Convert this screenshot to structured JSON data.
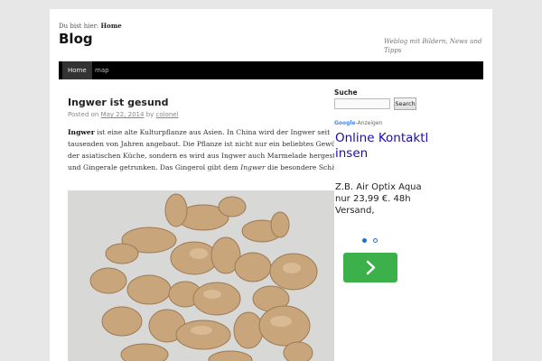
{
  "header": {
    "breadcrumb_prefix": "Du bist hier:",
    "breadcrumb_current": "Home",
    "site_title": "Blog",
    "site_description": "Weblog mit Bildern, News und Tipps"
  },
  "nav": {
    "items": [
      {
        "label": "Home",
        "active": true
      },
      {
        "label": "map",
        "active": false
      }
    ]
  },
  "post": {
    "title": "Ingwer ist gesund",
    "meta_prefix": "Posted on",
    "date": "May 22, 2014",
    "meta_by": "by",
    "author": "colonel",
    "intro_bold": "Ingwer",
    "text_1": " ist eine alte Kulturpflanze aus Asien. In China wird der Ingwer seit tausenden von Jahren angebaut. Die Pflanze ist nicht nur ein beliebtes Gewürz in der asiatischen Küche, sondern es wird aus Ingwer auch Marmelade hergestellt und Gingerale getrunken. Das Gingerol gibt dem ",
    "italic_word": "Ingwer",
    "text_2": " die besondere Schärfe."
  },
  "sidebar": {
    "search_title": "Suche",
    "search_value": "",
    "search_button": "Search",
    "ad": {
      "label_brand": "Google",
      "label_suffix": "-Anzeigen",
      "headline": "Online Kontaktlinsen",
      "body": "Z.B. Air Optix Aqua nur 23,99 €. 48h Versand,",
      "arrow_icon": "chevron-right-icon",
      "colors": {
        "headline": "#1a0dab",
        "button": "#3cb04a",
        "dots": "#1e6fd9"
      }
    }
  },
  "colors": {
    "nav_background": "#000000",
    "page_background": "#e7e7e7"
  }
}
